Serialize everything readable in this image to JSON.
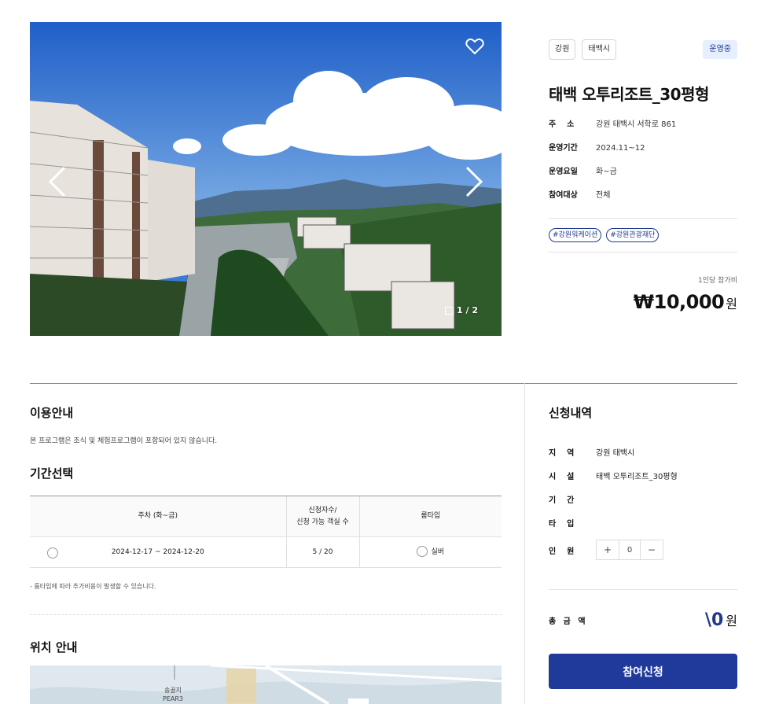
{
  "hero": {
    "counter": "1 / 2"
  },
  "info": {
    "chips": [
      "강원",
      "태백시"
    ],
    "status": "운영중",
    "title": "태백 오투리조트_30평형",
    "rows": [
      {
        "k": "주    소",
        "v": "강원 태백시 서학로 861"
      },
      {
        "k": "운영기간",
        "v": "2024.11~12"
      },
      {
        "k": "운영요일",
        "v": "화~금"
      },
      {
        "k": "참여대상",
        "v": "전체"
      }
    ],
    "hashtags": [
      "#강원워케이션",
      "#강원관광재단"
    ],
    "per_person": "1인당 참가비",
    "price": "₩10,000",
    "price_unit": "원"
  },
  "usage": {
    "title": "이용안내",
    "desc": "본 프로그램은 조식 및 체험프로그램이 포함되어 있지 않습니다."
  },
  "period": {
    "title": "기간선택",
    "headers": [
      "주차 (화~금)",
      "신청자수/",
      "신청 가능 객실 수",
      "룸타입"
    ],
    "row": {
      "dates": "2024-12-17 ~ 2024-12-20",
      "count": "5 / 20",
      "room": "실버"
    },
    "note": "-  룸타입에 따라 추가비용이 발생할 수 있습니다."
  },
  "location": {
    "title": "위치 안내",
    "map_label": "PEAR3",
    "map_label_ko": "송골지"
  },
  "summary": {
    "title": "신청내역",
    "rows": [
      {
        "k": "지    역",
        "v": "강원 태백시"
      },
      {
        "k": "시    설",
        "v": "태백 오투리조트_30평형"
      },
      {
        "k": "기    간",
        "v": ""
      },
      {
        "k": "타    입",
        "v": ""
      }
    ],
    "people_label": "인    원",
    "people_value": "0",
    "total_label": "총 금 액",
    "total_value": "\\0",
    "total_unit": "원",
    "submit": "참여신청"
  }
}
